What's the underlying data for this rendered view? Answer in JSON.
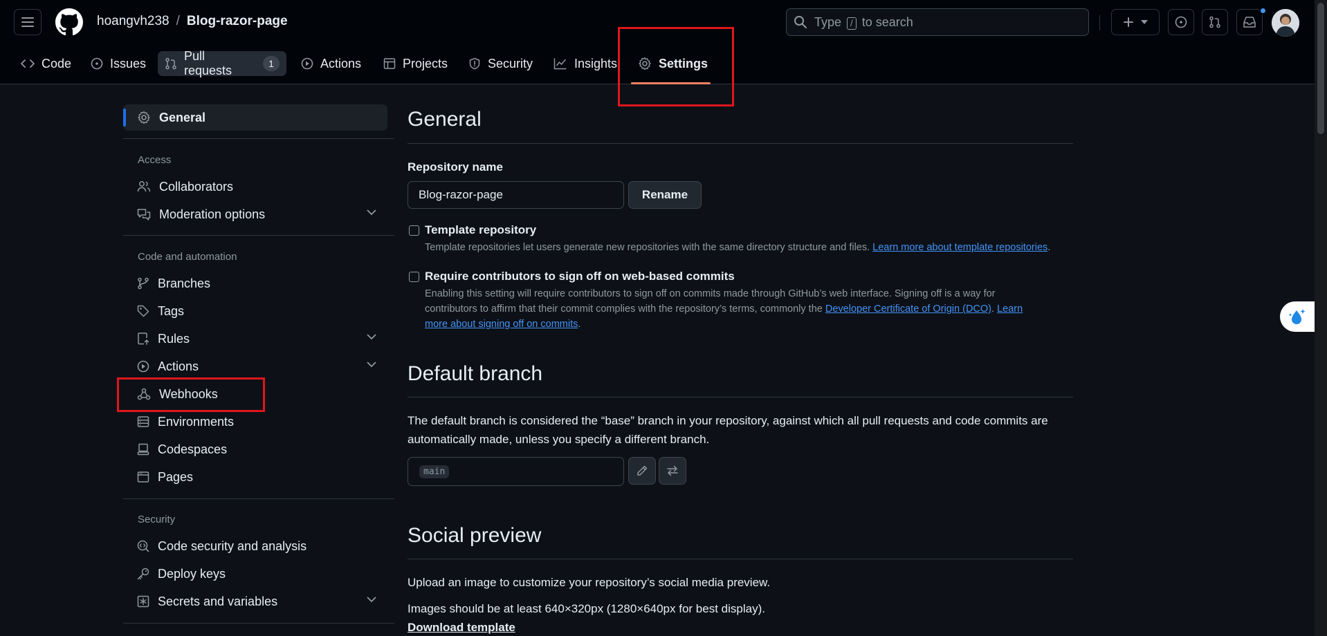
{
  "header": {
    "owner": "hoangvh238",
    "separator": "/",
    "repo": "Blog-razor-page",
    "search_prefix": "Type",
    "search_key": "/",
    "search_suffix": "to search",
    "icons": [
      "hamburger-icon",
      "github-logo",
      "search-icon",
      "plus-icon",
      "triangle-down-icon",
      "issue-opened-icon",
      "git-pull-request-icon",
      "inbox-icon"
    ]
  },
  "tabs": [
    {
      "label": "Code",
      "icon": "code-icon"
    },
    {
      "label": "Issues",
      "icon": "issue-opened-icon"
    },
    {
      "label": "Pull requests",
      "icon": "git-pull-request-icon",
      "count": "1"
    },
    {
      "label": "Actions",
      "icon": "play-icon"
    },
    {
      "label": "Projects",
      "icon": "table-icon"
    },
    {
      "label": "Security",
      "icon": "shield-icon"
    },
    {
      "label": "Insights",
      "icon": "graph-icon"
    },
    {
      "label": "Settings",
      "icon": "gear-icon",
      "selected": true
    }
  ],
  "sidebar": {
    "general": "General",
    "access_heading": "Access",
    "collaborators": "Collaborators",
    "moderation": "Moderation options",
    "code_heading": "Code and automation",
    "branches": "Branches",
    "tags": "Tags",
    "rules": "Rules",
    "actions": "Actions",
    "webhooks": "Webhooks",
    "environments": "Environments",
    "codespaces": "Codespaces",
    "pages": "Pages",
    "security_heading": "Security",
    "code_security": "Code security and analysis",
    "deploy_keys": "Deploy keys",
    "secrets": "Secrets and variables"
  },
  "main": {
    "general_title": "General",
    "repo_name_label": "Repository name",
    "repo_name_value": "Blog-razor-page",
    "rename_button": "Rename",
    "template_title": "Template repository",
    "template_desc": "Template repositories let users generate new repositories with the same directory structure and files.",
    "template_link": "Learn more about template repositories",
    "template_period": ".",
    "signoff_title": "Require contributors to sign off on web-based commits",
    "signoff_desc_1": "Enabling this setting will require contributors to sign off on commits made through GitHub’s web interface. Signing off is a way for",
    "signoff_desc_2": "contributors to affirm that their commit complies with the repository’s terms, commonly the",
    "signoff_link_dco": "Developer Certificate of Origin (DCO)",
    "signoff_period": ".",
    "signoff_link_learn_1": "Learn",
    "signoff_link_learn_2": "more about signing off on commits",
    "default_branch_title": "Default branch",
    "default_branch_desc_1": "The default branch is considered the “base” branch in your repository, against which all pull requests and code commits are",
    "default_branch_desc_2": "automatically made, unless you specify a different branch.",
    "default_branch_value": "main",
    "social_title": "Social preview",
    "social_desc": "Upload an image to customize your repository’s social media preview.",
    "social_size": "Images should be at least 640×320px (1280×640px for best display).",
    "download_template": "Download template"
  },
  "colors": {
    "background": "#0d1117",
    "header_bg": "#010409",
    "accent_link": "#4493f8",
    "tab_underline": "#f78166",
    "active_bar": "#1f6feb",
    "highlight_box": "#e0161d"
  }
}
